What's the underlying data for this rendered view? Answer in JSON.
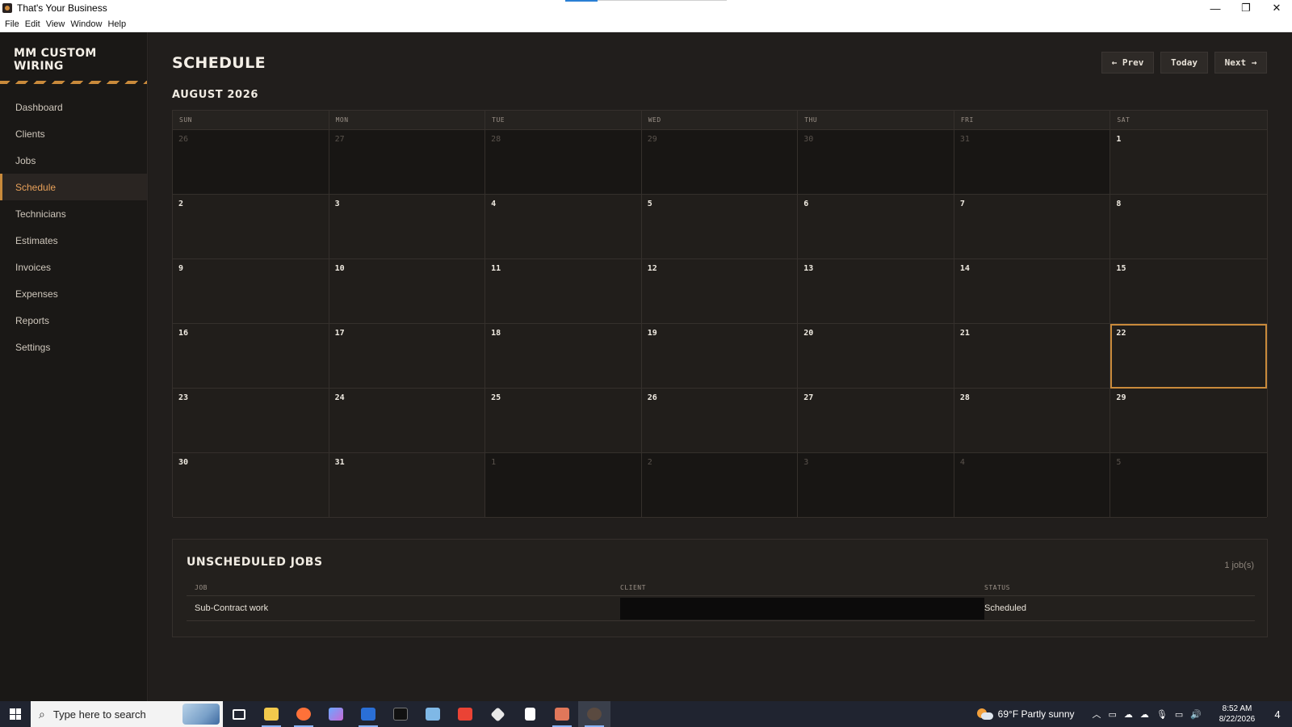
{
  "window": {
    "title": "That's Your Business",
    "minimize": "—",
    "restore": "❐",
    "close": "✕"
  },
  "menu": [
    "File",
    "Edit",
    "View",
    "Window",
    "Help"
  ],
  "sidebar": {
    "brand_line1": "MM CUSTOM",
    "brand_line2": "WIRING",
    "items": [
      {
        "label": "Dashboard"
      },
      {
        "label": "Clients"
      },
      {
        "label": "Jobs"
      },
      {
        "label": "Schedule",
        "active": true
      },
      {
        "label": "Technicians"
      },
      {
        "label": "Estimates"
      },
      {
        "label": "Invoices"
      },
      {
        "label": "Expenses"
      },
      {
        "label": "Reports"
      },
      {
        "label": "Settings"
      }
    ]
  },
  "page": {
    "title": "SCHEDULE",
    "month": "AUGUST 2026",
    "prev_label": "← Prev",
    "today_label": "Today",
    "next_label": "Next →"
  },
  "calendar": {
    "weekdays": [
      "SUN",
      "MON",
      "TUE",
      "WED",
      "THU",
      "FRI",
      "SAT"
    ],
    "weeks": [
      [
        {
          "d": "26",
          "out": true
        },
        {
          "d": "27",
          "out": true
        },
        {
          "d": "28",
          "out": true
        },
        {
          "d": "29",
          "out": true
        },
        {
          "d": "30",
          "out": true
        },
        {
          "d": "31",
          "out": true
        },
        {
          "d": "1"
        }
      ],
      [
        {
          "d": "2"
        },
        {
          "d": "3"
        },
        {
          "d": "4"
        },
        {
          "d": "5"
        },
        {
          "d": "6"
        },
        {
          "d": "7"
        },
        {
          "d": "8"
        }
      ],
      [
        {
          "d": "9"
        },
        {
          "d": "10"
        },
        {
          "d": "11"
        },
        {
          "d": "12"
        },
        {
          "d": "13"
        },
        {
          "d": "14"
        },
        {
          "d": "15"
        }
      ],
      [
        {
          "d": "16"
        },
        {
          "d": "17"
        },
        {
          "d": "18"
        },
        {
          "d": "19"
        },
        {
          "d": "20"
        },
        {
          "d": "21"
        },
        {
          "d": "22",
          "today": true
        }
      ],
      [
        {
          "d": "23"
        },
        {
          "d": "24"
        },
        {
          "d": "25"
        },
        {
          "d": "26"
        },
        {
          "d": "27"
        },
        {
          "d": "28"
        },
        {
          "d": "29"
        }
      ],
      [
        {
          "d": "30"
        },
        {
          "d": "31"
        },
        {
          "d": "1",
          "out": true
        },
        {
          "d": "2",
          "out": true
        },
        {
          "d": "3",
          "out": true
        },
        {
          "d": "4",
          "out": true
        },
        {
          "d": "5",
          "out": true
        }
      ]
    ]
  },
  "unscheduled": {
    "title": "UNSCHEDULED JOBS",
    "count": "1 job(s)",
    "headers": {
      "job": "JOB",
      "client": "CLIENT",
      "status": "STATUS"
    },
    "rows": [
      {
        "job": "Sub-Contract work",
        "client": "",
        "status": "Scheduled"
      }
    ]
  },
  "taskbar": {
    "search_placeholder": "Type here to search",
    "weather": "69°F  Partly sunny",
    "time": "8:52 AM",
    "date": "8/22/2026",
    "notification_count": "4",
    "apps": [
      {
        "icon": "task-view-icon",
        "color": "#ffffff"
      },
      {
        "icon": "file-explorer-icon",
        "color": "#f2c94c"
      },
      {
        "icon": "firefox-icon",
        "color": "#ff7139"
      },
      {
        "icon": "copilot-icon",
        "color": "#6aa8ff"
      },
      {
        "icon": "powershell-icon",
        "color": "#2a6fd6"
      },
      {
        "icon": "terminal-icon",
        "color": "#111111"
      },
      {
        "icon": "notepad-icon",
        "color": "#7fb8e6"
      },
      {
        "icon": "gmail-icon",
        "color": "#ea4335"
      },
      {
        "icon": "git-icon",
        "color": "#e8e8e8"
      },
      {
        "icon": "claude-app-icon",
        "color": "#ffffff"
      },
      {
        "icon": "claude-icon",
        "color": "#e0775a"
      },
      {
        "icon": "business-app-icon",
        "color": "#5a4a40"
      }
    ]
  },
  "colors": {
    "accent": "#c98a3b",
    "active_nav_text": "#e8a15a",
    "background": "#211e1c",
    "sidebar": "#1a1816"
  }
}
